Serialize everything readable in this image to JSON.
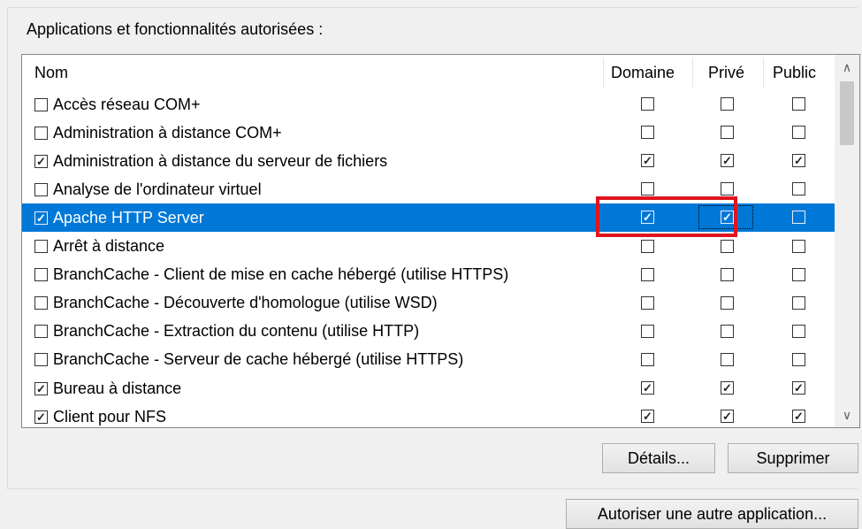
{
  "group": {
    "caption": "Applications et fonctionnalités autorisées :"
  },
  "list": {
    "headers": {
      "name": "Nom",
      "domain": "Domaine",
      "private": "Privé",
      "public": "Public"
    },
    "rows": [
      {
        "name": "Accès réseau COM+",
        "enabled": false,
        "domain": false,
        "private": false,
        "public": false
      },
      {
        "name": "Administration à distance COM+",
        "enabled": false,
        "domain": false,
        "private": false,
        "public": false
      },
      {
        "name": "Administration à distance du serveur de fichiers",
        "enabled": true,
        "domain": true,
        "private": true,
        "public": true
      },
      {
        "name": "Analyse de l'ordinateur virtuel",
        "enabled": false,
        "domain": false,
        "private": false,
        "public": false
      },
      {
        "name": "Apache HTTP Server",
        "enabled": true,
        "domain": true,
        "private": true,
        "public": false,
        "selected": true
      },
      {
        "name": "Arrêt à distance",
        "enabled": false,
        "domain": false,
        "private": false,
        "public": false
      },
      {
        "name": "BranchCache - Client de mise en cache hébergé (utilise HTTPS)",
        "enabled": false,
        "domain": false,
        "private": false,
        "public": false
      },
      {
        "name": "BranchCache - Découverte d'homologue (utilise WSD)",
        "enabled": false,
        "domain": false,
        "private": false,
        "public": false
      },
      {
        "name": "BranchCache - Extraction du contenu (utilise HTTP)",
        "enabled": false,
        "domain": false,
        "private": false,
        "public": false
      },
      {
        "name": "BranchCache - Serveur de cache hébergé (utilise HTTPS)",
        "enabled": false,
        "domain": false,
        "private": false,
        "public": false
      },
      {
        "name": "Bureau à distance",
        "enabled": true,
        "domain": true,
        "private": true,
        "public": true
      },
      {
        "name": "Client pour NFS",
        "enabled": true,
        "domain": true,
        "private": true,
        "public": true
      }
    ]
  },
  "scroll": {
    "up_icon": "chevron-up-icon",
    "down_icon": "chevron-down-icon"
  },
  "buttons": {
    "details": "Détails...",
    "remove": "Supprimer",
    "allow_other": "Autoriser une autre application..."
  },
  "colors": {
    "selection": "#0078d7",
    "highlight": "#e0141e"
  }
}
